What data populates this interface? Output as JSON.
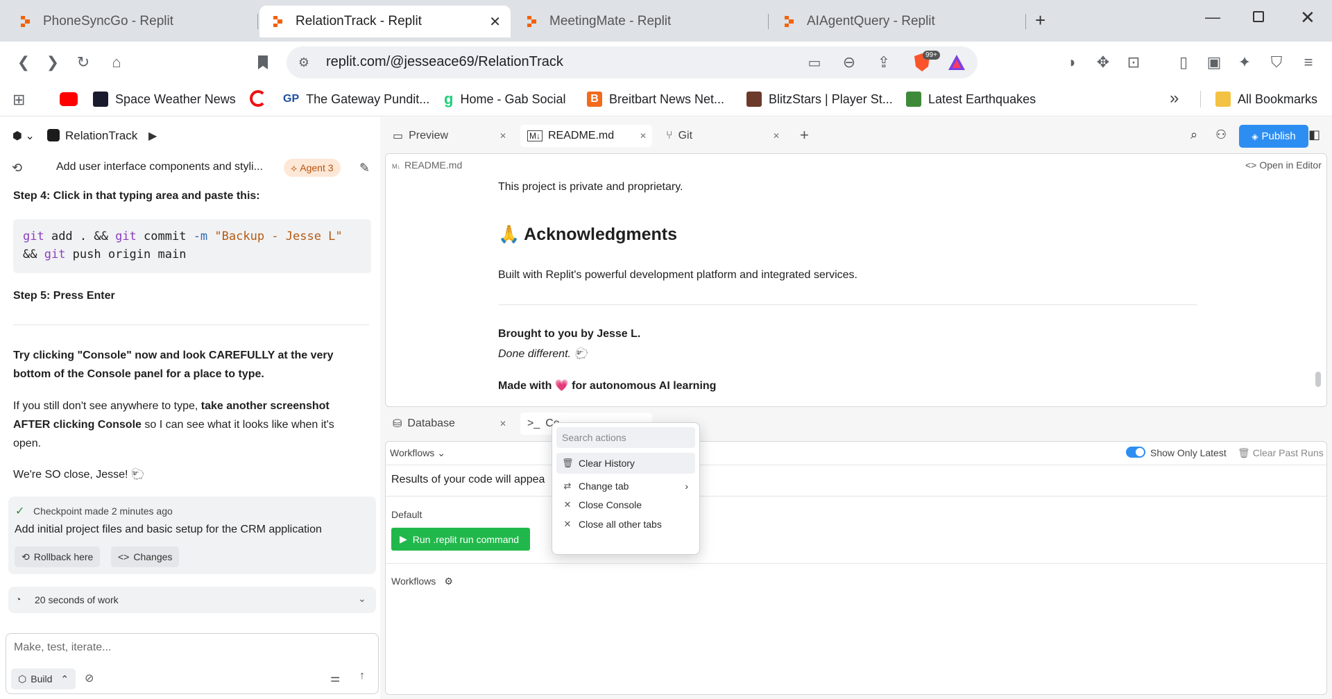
{
  "browser": {
    "tabs": [
      {
        "title": "PhoneSyncGo - Replit"
      },
      {
        "title": "RelationTrack - Replit"
      },
      {
        "title": "MeetingMate - Replit"
      },
      {
        "title": "AIAgentQuery - Replit"
      }
    ],
    "url": "replit.com/@jesseace69/RelationTrack",
    "badge": "99+",
    "bookmarks": [
      {
        "label": "Space Weather News"
      },
      {
        "label": "The Gateway Pundit..."
      },
      {
        "label": "Home - Gab Social"
      },
      {
        "label": "Breitbart News Net..."
      },
      {
        "label": "BlitzStars | Player St..."
      },
      {
        "label": "Latest Earthquakes"
      }
    ],
    "all_bookmarks": "All Bookmarks",
    "more": "»"
  },
  "replit": {
    "project_name": "RelationTrack",
    "agent": {
      "thread_title": "Add user interface components and styli...",
      "agent_badge": "Agent 3",
      "step4": "Step 4: Click in that typing area and paste this:",
      "code_line1_cmd1": "git",
      "code_line1_a": " add . && ",
      "code_line1_cmd2": "git",
      "code_line1_b": " commit ",
      "code_line1_flag": "-m",
      "code_line1_str": " \"Backup - Jesse L\"",
      "code_line2_a": "&& ",
      "code_line2_cmd": "git",
      "code_line2_b": " push origin main",
      "step5": "Step 5: Press Enter",
      "para1": "Try clicking \"Console\" now and look CAREFULLY at the very bottom of the Console panel for a place to type.",
      "para2_a": "If you still don't see anywhere to type, ",
      "para2_b": "take another screenshot AFTER clicking Console",
      "para2_c": " so I can see what it looks like when it's open.",
      "para3": "We're SO close, Jesse! 🐑",
      "checkpoint_label": "Checkpoint made",
      "checkpoint_time": "2 minutes ago",
      "checkpoint_desc": "Add initial project files and basic setup for the CRM application",
      "rollback": "Rollback here",
      "changes": "Changes",
      "work_time": "20 seconds of work",
      "input_placeholder": "Make, test, iterate...",
      "mode": "Build"
    },
    "top_tabs": [
      {
        "label": "Preview"
      },
      {
        "label": "README.md"
      },
      {
        "label": "Git"
      }
    ],
    "publish": "Publish",
    "readme": {
      "file": "README.md",
      "open_in_editor": "Open in Editor",
      "line_private": "This project is private and proprietary.",
      "ack_heading": "🙏 Acknowledgments",
      "ack_text": "Built with Replit's powerful development platform and integrated services.",
      "brought": "Brought to you by Jesse L.",
      "done": "Done different. 🐑",
      "made_a": "Made with ",
      "made_heart": "💗",
      "made_b": " for autonomous AI learning"
    },
    "bottom_tabs": [
      {
        "label": "Database"
      },
      {
        "label": "Co"
      }
    ],
    "console": {
      "workflows": "Workflows",
      "show_latest": "Show Only Latest",
      "clear_past": "Clear Past Runs",
      "results": "Results of your code will appea",
      "default": "Default",
      "run_button": "Run .replit run command",
      "workflows2": "Workflows"
    },
    "context_menu": {
      "search_placeholder": "Search actions",
      "items": [
        {
          "label": "Clear History"
        },
        {
          "label": "Change tab"
        },
        {
          "label": "Close Console"
        },
        {
          "label": "Close all other tabs"
        }
      ]
    }
  },
  "colors": {
    "replit_orange": "#f26207",
    "run_green": "#21b84b",
    "publish_blue": "#2d8ef2",
    "agent_badge_bg": "#fde7d6"
  }
}
